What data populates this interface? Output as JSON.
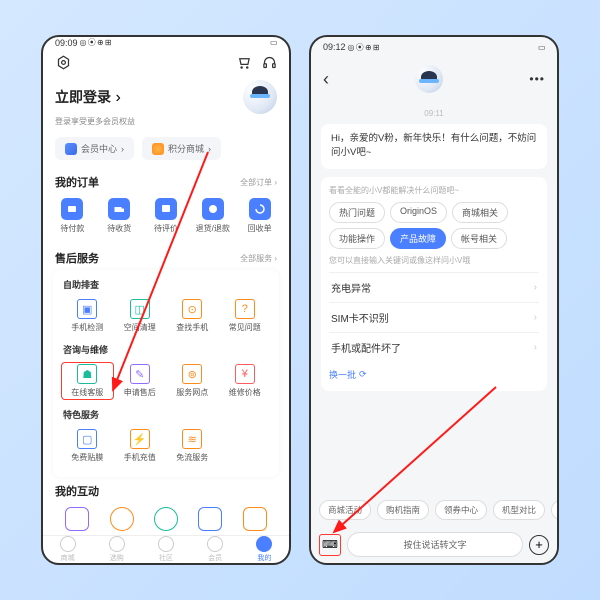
{
  "left": {
    "status": {
      "time": "09:09",
      "icons": "◎ ⦿ ⊕ ⊞",
      "battery": "▭"
    },
    "login_title": "立即登录",
    "login_arrow": "›",
    "login_sub": "登录享受更多会员权益",
    "chips": [
      {
        "label": "会员中心",
        "arrow": "›"
      },
      {
        "label": "积分商城",
        "arrow": "›"
      }
    ],
    "orders": {
      "title": "我的订单",
      "more": "全部订单 ›",
      "items": [
        {
          "label": "待付款"
        },
        {
          "label": "待收货"
        },
        {
          "label": "待评价"
        },
        {
          "label": "退货/退款"
        },
        {
          "label": "回收单"
        }
      ]
    },
    "aftersale": {
      "title": "售后服务",
      "more": "全部服务 ›",
      "sec1_title": "自助排查",
      "sec1": [
        {
          "label": "手机检测"
        },
        {
          "label": "空间清理"
        },
        {
          "label": "查找手机"
        },
        {
          "label": "常见问题"
        }
      ],
      "sec2_title": "咨询与维修",
      "sec2": [
        {
          "label": "在线客服"
        },
        {
          "label": "申请售后"
        },
        {
          "label": "服务网点"
        },
        {
          "label": "维修价格"
        }
      ],
      "sec3_title": "特色服务",
      "sec3": [
        {
          "label": "免费贴膜"
        },
        {
          "label": "手机充值"
        },
        {
          "label": "免流服务"
        }
      ]
    },
    "interact": {
      "title": "我的互动"
    },
    "nav": [
      {
        "label": "商城"
      },
      {
        "label": "选购"
      },
      {
        "label": "社区"
      },
      {
        "label": "会员"
      },
      {
        "label": "我的"
      }
    ]
  },
  "right": {
    "status": {
      "time": "09:12",
      "icons": "◎ ⦿ ⊕ ⊞",
      "battery": "▭"
    },
    "timestamp": "09:11",
    "greeting": "Hi，亲爱的V粉，新年快乐！有什么问题，不妨问问小V吧~",
    "hint1": "看看全能的小V都能解决什么问题吧~",
    "tags": [
      {
        "label": "热门问题"
      },
      {
        "label": "OriginOS"
      },
      {
        "label": "商城相关"
      },
      {
        "label": "功能操作"
      },
      {
        "label": "产品故障",
        "active": true
      },
      {
        "label": "帐号相关"
      }
    ],
    "hint2": "您可以直接输入关键词或像这样问小V哦",
    "options": [
      {
        "label": "充电异常"
      },
      {
        "label": "SIM卡不识别"
      },
      {
        "label": "手机或配件坏了"
      }
    ],
    "refresh": "换一批",
    "refresh_icon": "⟳",
    "suggest": [
      {
        "label": "商城活动"
      },
      {
        "label": "购机指南"
      },
      {
        "label": "领券中心"
      },
      {
        "label": "机型对比"
      },
      {
        "label": "以"
      }
    ],
    "voice": "按住说话转文字",
    "dots": "•••",
    "back": "‹",
    "chev": "›",
    "plus": "+",
    "kbd": "⌨"
  }
}
